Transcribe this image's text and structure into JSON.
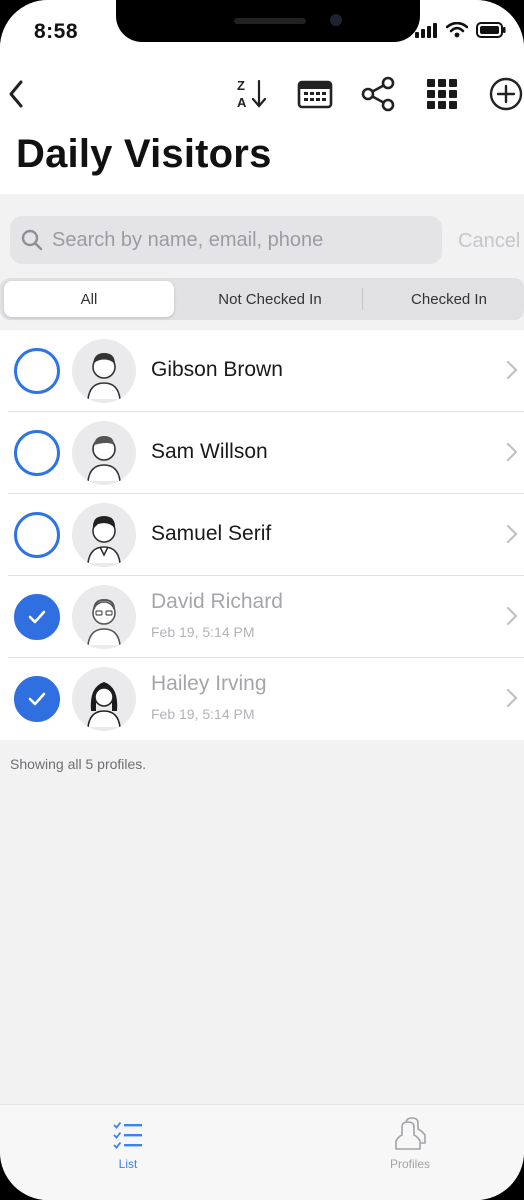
{
  "status": {
    "time": "8:58"
  },
  "nav": {
    "back": "back-chevron-icon",
    "actions": [
      "sort-za-icon",
      "calendar-icon",
      "share-icon",
      "grid-icon",
      "add-circle-icon"
    ]
  },
  "title": "Daily Visitors",
  "search": {
    "placeholder": "Search by name, email, phone",
    "cancel_label": "Cancel"
  },
  "segments": [
    {
      "label": "All",
      "active": true
    },
    {
      "label": "Not Checked In",
      "active": false
    },
    {
      "label": "Checked In",
      "active": false
    }
  ],
  "visitors": [
    {
      "name": "Gibson Brown",
      "checked_in": false,
      "time": ""
    },
    {
      "name": "Sam Willson",
      "checked_in": false,
      "time": ""
    },
    {
      "name": "Samuel Serif",
      "checked_in": false,
      "time": ""
    },
    {
      "name": "David Richard",
      "checked_in": true,
      "time": "Feb 19, 5:14 PM"
    },
    {
      "name": "Hailey Irving",
      "checked_in": true,
      "time": "Feb 19, 5:14 PM"
    }
  ],
  "footer_note": "Showing all 5 profiles.",
  "tabs": [
    {
      "label": "List",
      "icon": "list-icon",
      "active": true
    },
    {
      "label": "Profiles",
      "icon": "profiles-icon",
      "active": false
    }
  ],
  "colors": {
    "accent": "#2f6fe0",
    "background": "#f2f2f3"
  }
}
